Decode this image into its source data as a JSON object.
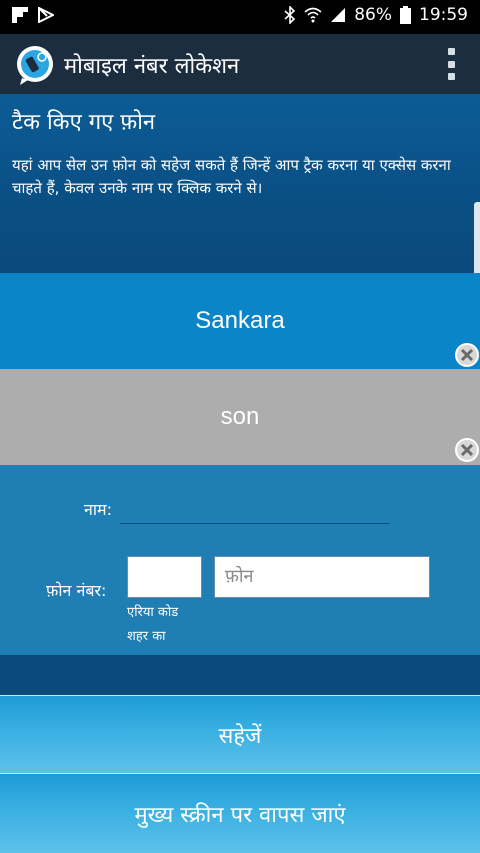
{
  "status_bar": {
    "battery": "86%",
    "time": "19:59"
  },
  "app_bar": {
    "title": "मोबाइल नंबर लोकेशन"
  },
  "header": {
    "title": "टैक किए गए फ़ोन",
    "description": "यहां आप सेल उन फ़ोन को सहेज सकते हैं जिन्हें आप ट्रैक करना या एक्सेस करना चाहते हैं, केवल उनके नाम पर क्लिक करने से।"
  },
  "tracked_phones": [
    {
      "name": "Sankara",
      "color": "#0b84c8"
    },
    {
      "name": "son",
      "color": "#adadad"
    }
  ],
  "form": {
    "name_label": "नाम:",
    "name_value": "",
    "phone_label": "फ़ोन नंबर:",
    "area_code_value": "",
    "phone_placeholder": "फ़ोन",
    "area_code_hint": "एरिया कोड",
    "city_hint": "शहर का"
  },
  "buttons": {
    "save": "सहेजें",
    "back": "मुख्य स्क्रीन पर वापस जाएं"
  }
}
